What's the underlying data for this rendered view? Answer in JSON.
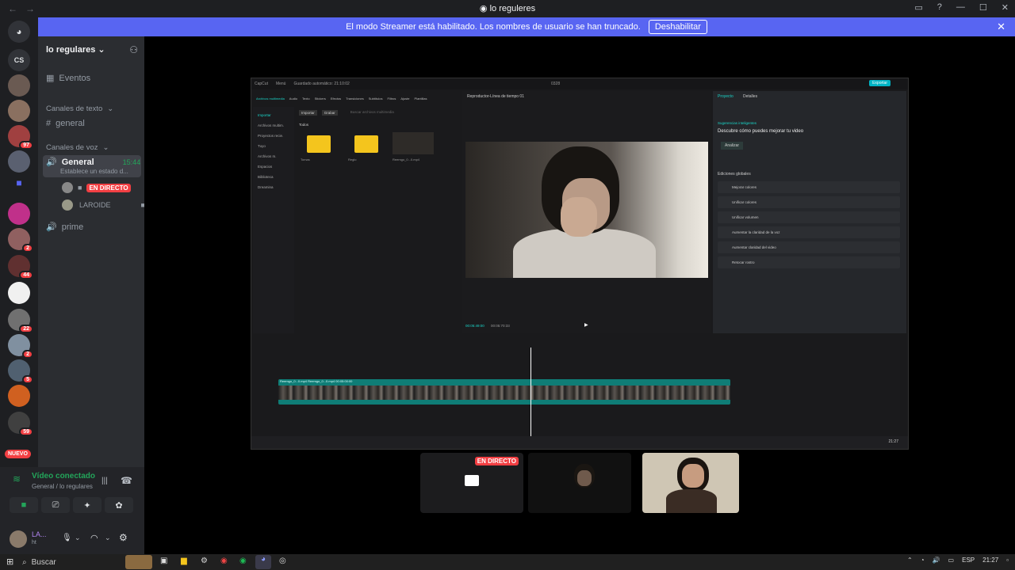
{
  "window": {
    "title": "lo reguleres"
  },
  "banner": {
    "text": "El modo Streamer está habilitado. Los nombres de usuario se han truncado.",
    "button": "Deshabilitar"
  },
  "rail": {
    "top_label": "CS",
    "badges": [
      "97",
      "2",
      "44",
      "22",
      "2",
      "5",
      "59"
    ],
    "new_label": "NUEVO"
  },
  "sidebar": {
    "server_name": "lo regulares",
    "events": "Eventos",
    "text_category": "Canales de texto",
    "text_channel": "general",
    "voice_category": "Canales de voz",
    "voice_channel": "General",
    "voice_time": "15:44",
    "voice_status": "Establece un estado d...",
    "live_badge": "EN DIRECTO",
    "member_2": "LAROIDE",
    "voice_channel_2": "prime"
  },
  "voice_panel": {
    "status": "Vídeo conectado",
    "location": "General / lo regulares",
    "user": "LA...",
    "user_sub": "ht"
  },
  "stream": {
    "capcut": {
      "autosave": "Guardado automático: 21:10:02",
      "project_name": "0328",
      "export": "Exportar",
      "media_tabs": [
        "Archivos multimedia",
        "Audio",
        "Texto",
        "Stickers",
        "Efectos",
        "Transiciones",
        "Subtítulos",
        "Filtros",
        "Ajuste",
        "Plantillas"
      ],
      "side_items": [
        "Importar",
        "Archivos multim.",
        "Proyectos recie.",
        "Tuyo",
        "Archivos m.",
        "Espacios",
        "Biblioteca",
        "Dreamina"
      ],
      "import_btn": "Importar",
      "record_btn": "Grabar",
      "search_placeholder": "Buscar archivos multimedia",
      "all_label": "Todos",
      "folders": [
        "Tomas",
        "Reglo"
      ],
      "clip_name": "Reemgo_0...0.mp4",
      "preview_title": "Reproductor-Línea de tiempo 01",
      "timecode": "00:05:49:00",
      "duration": "00:05:70:33",
      "right_tabs": [
        "Proyecto",
        "Detalles"
      ],
      "smart_title": "Sugerencias inteligentes",
      "smart_heading": "Descubre cómo puedes mejorar tu video",
      "analyze": "Analizar",
      "global_edits": "Ediciones globales",
      "edits": [
        "Mejorar colores",
        "Unificar colores",
        "Unificar volumen",
        "Aumentar la claridad de la voz",
        "Aumentar claridad del video",
        "Retocar rostro"
      ],
      "track_label": "Reemgo_0...0.mp4  Reemgo_0...0.mp4  00:05:00:00",
      "clock": "21:27"
    }
  },
  "tiles": {
    "live_badge": "EN DIRECTO"
  },
  "taskbar": {
    "search": "Buscar",
    "lang": "ESP",
    "time": "21:27"
  }
}
